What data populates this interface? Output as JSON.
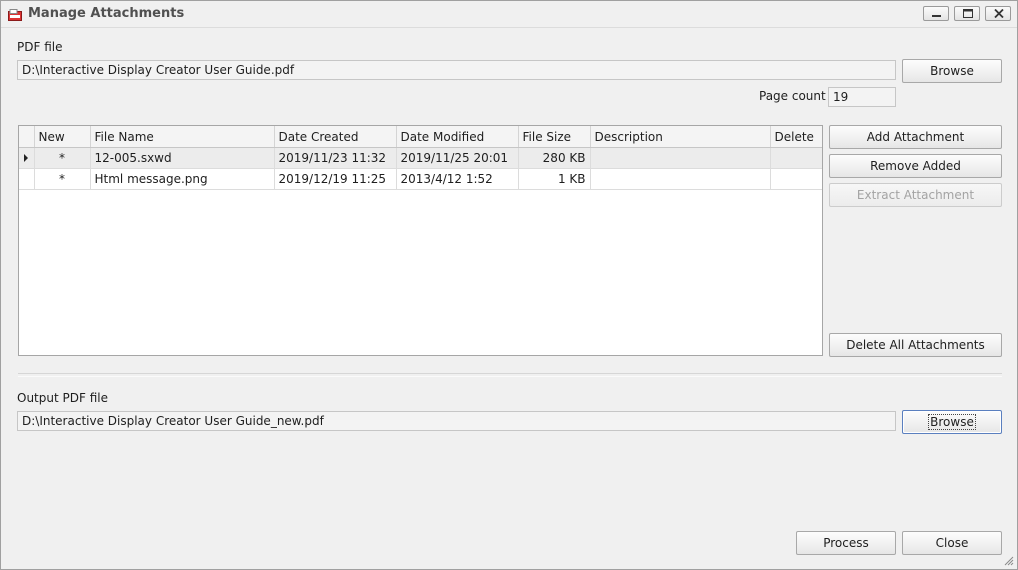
{
  "window": {
    "title": "Manage Attachments"
  },
  "pdf_file": {
    "label": "PDF file",
    "value": "D:\\Interactive Display Creator User Guide.pdf",
    "browse_label": "Browse"
  },
  "page_count": {
    "label": "Page count",
    "value": "19"
  },
  "attachments": {
    "columns": [
      "New",
      "File Name",
      "Date Created",
      "Date Modified",
      "File Size",
      "Description",
      "Delete"
    ],
    "rows": [
      {
        "new": "*",
        "file_name": "12-005.sxwd",
        "date_created": "2019/11/23 11:32",
        "date_modified": "2019/11/25 20:01",
        "file_size": "280 KB",
        "description": "",
        "delete": ""
      },
      {
        "new": "*",
        "file_name": "Html message.png",
        "date_created": "2019/12/19 11:25",
        "date_modified": "2013/4/12 1:52",
        "file_size": "1 KB",
        "description": "",
        "delete": ""
      }
    ]
  },
  "actions": {
    "add_attachment": "Add Attachment",
    "remove_added": "Remove Added",
    "extract_attachment": "Extract Attachment",
    "delete_all": "Delete All Attachments"
  },
  "output_pdf": {
    "label": "Output PDF file",
    "value": "D:\\Interactive Display Creator User Guide_new.pdf",
    "browse_label": "Browse"
  },
  "footer": {
    "process_label": "Process",
    "close_label": "Close"
  },
  "colors": {
    "selected_row": "#ececec",
    "focus_border": "#5a7fbf",
    "disabled_text": "#a3a3a3"
  }
}
